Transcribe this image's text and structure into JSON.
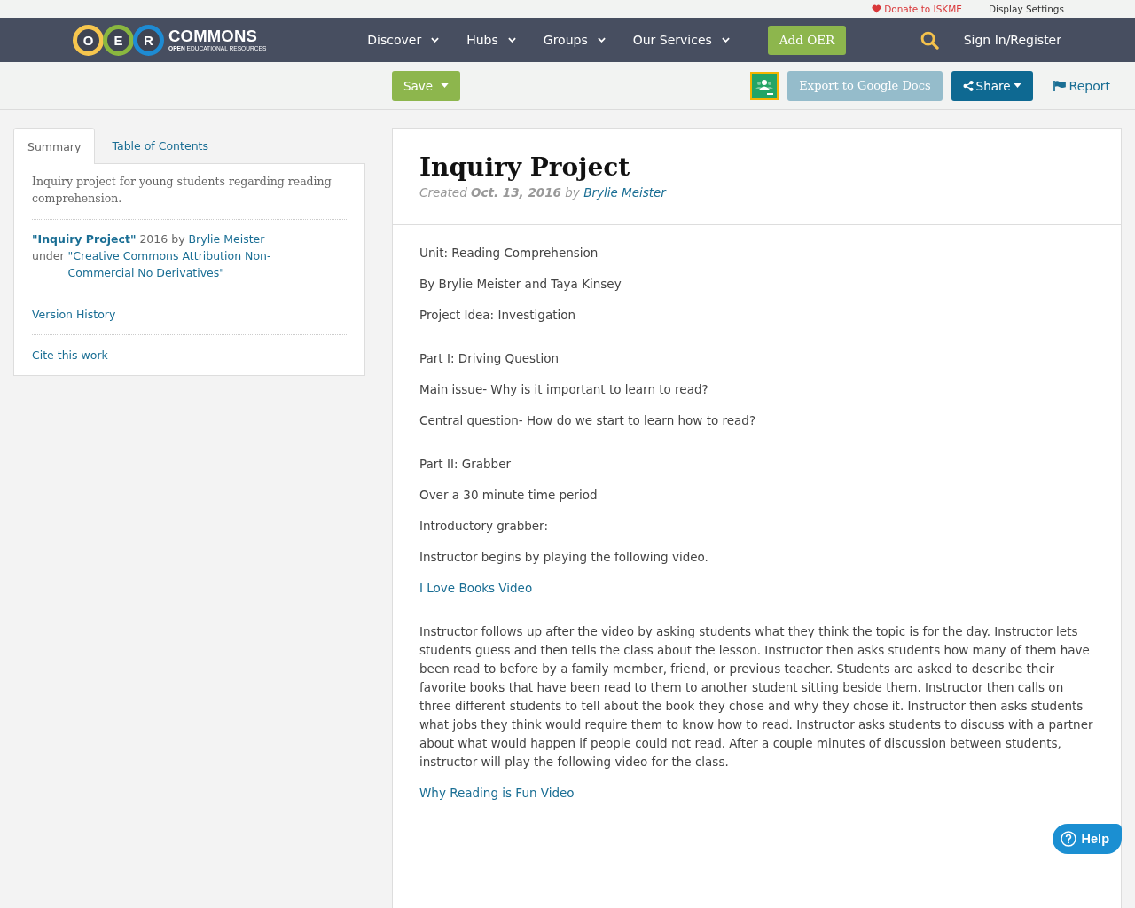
{
  "top_bar": {
    "donate": "Donate to ISKME",
    "display_settings": "Display Settings"
  },
  "nav": {
    "logo": {
      "letters": [
        {
          "letter": "O",
          "color": "#f7c64e"
        },
        {
          "letter": "E",
          "color": "#8ab73f"
        },
        {
          "letter": "R",
          "color": "#1e8bd3"
        }
      ],
      "wordmark": "COMMONS",
      "tagline": "**OPEN** EDUCATIONAL RESOURCES"
    },
    "menu": [
      {
        "label": "Discover"
      },
      {
        "label": "Hubs"
      },
      {
        "label": "Groups"
      },
      {
        "label": "Our Services"
      }
    ],
    "add_button": "Add OER",
    "sign_in": "Sign In/Register"
  },
  "toolbar": {
    "save": "Save",
    "export": "Export to Google Docs",
    "share": "Share",
    "report": "Report"
  },
  "sidebar": {
    "tabs": [
      {
        "label": "Summary",
        "selected": true
      },
      {
        "label": "Table of Contents",
        "selected": false
      }
    ],
    "description": "Inquiry project for young students regarding reading comprehension.",
    "attribution": {
      "title": "\"Inquiry Project\"",
      "year_by": "2016 by",
      "author": "Brylie Meister",
      "under": "under",
      "license": "\"Creative Commons Attribution Non-Commercial No Derivatives\""
    },
    "links": [
      "Version History",
      "Cite this work"
    ]
  },
  "resource": {
    "title": "Inquiry Project",
    "created": "Created **Oct. 13, 2016** by",
    "author": "Brylie Meister",
    "sections": [
      [
        {
          "kind": "text",
          "text": "Unit: Reading Comprehension"
        },
        {
          "kind": "text",
          "text": "By Brylie Meister and Taya Kinsey"
        },
        {
          "kind": "text",
          "text": "Project Idea: Investigation"
        }
      ],
      [
        {
          "kind": "text",
          "text": "Part I: Driving Question"
        },
        {
          "kind": "text",
          "text": "Main issue- Why is it important to learn to read?"
        },
        {
          "kind": "text",
          "text": "Central question- How do we start to learn how to read?"
        }
      ],
      [
        {
          "kind": "text",
          "text": "Part II: Grabber"
        },
        {
          "kind": "text",
          "text": "Over a 30 minute time period"
        },
        {
          "kind": "text",
          "text": "Introductory grabber:"
        },
        {
          "kind": "text",
          "text": "Instructor begins by playing the following video."
        },
        {
          "kind": "link",
          "text": "I Love Books Video"
        }
      ],
      [
        {
          "kind": "text",
          "text": "Instructor follows up after the video by asking students what they think the topic is for the day. Instructor lets students guess and then tells the class about the lesson. Instructor then asks students how many of them have been read to before by a family member, friend, or previous teacher. Students are asked to describe their favorite books that have been read to them to another student sitting beside them. Instructor then calls on three different students to tell about the book they chose and why they chose it. Instructor then asks students what jobs they think would require them to know how to read. Instructor asks students to discuss with a partner about what would happen if people could not read. After a couple minutes of discussion between students, instructor will play the following video for the class."
        },
        {
          "kind": "link",
          "text": "Why Reading is Fun Video"
        }
      ]
    ]
  },
  "help_button": "Help"
}
